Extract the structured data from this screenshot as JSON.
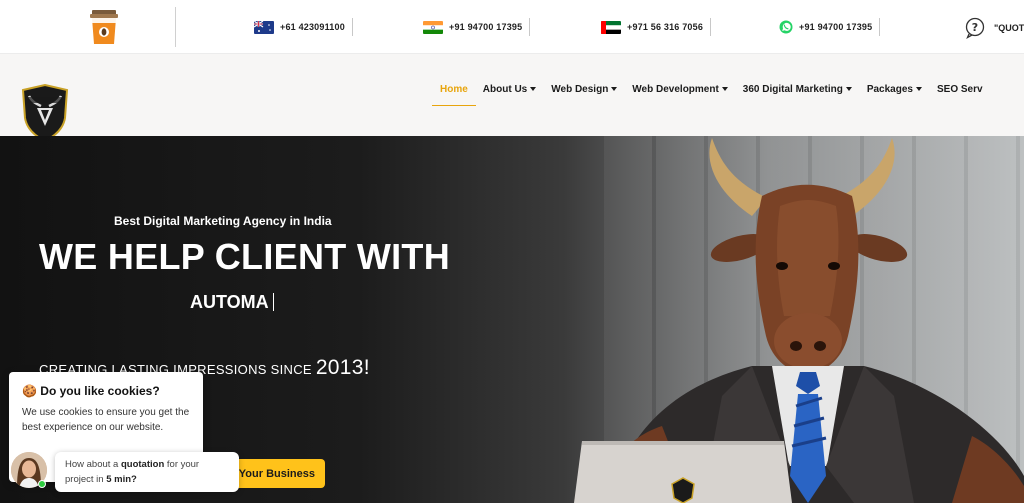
{
  "topbar": {
    "contacts": [
      {
        "flag": "australia-flag",
        "phone": "+61 423091100"
      },
      {
        "flag": "india-flag",
        "phone": "+91 94700 17395"
      },
      {
        "flag": "uae-flag",
        "phone": "+971 56 316 7056"
      },
      {
        "flag": "whatsapp-icon",
        "phone": "+91 94700 17395"
      }
    ],
    "quote_label": "\"QUOTE"
  },
  "nav": {
    "items": [
      {
        "label": "Home",
        "active": true,
        "dropdown": false
      },
      {
        "label": "About Us",
        "active": false,
        "dropdown": true
      },
      {
        "label": "Web Design",
        "active": false,
        "dropdown": true
      },
      {
        "label": "Web Development",
        "active": false,
        "dropdown": true
      },
      {
        "label": "360 Digital Marketing",
        "active": false,
        "dropdown": true
      },
      {
        "label": "Packages",
        "active": false,
        "dropdown": true
      },
      {
        "label": "SEO Serv",
        "active": false,
        "dropdown": false
      }
    ]
  },
  "hero": {
    "subtitle": "Best Digital Marketing Agency in India",
    "headline": "WE HELP CLIENT WITH",
    "typed_text": "AUTOMA",
    "since_text": "CREATING LASTING IMPRESSIONS SINCE",
    "since_year": "2013!",
    "cta_label": "Your Business"
  },
  "cookie": {
    "title": "Do you like cookies?",
    "body": "We use cookies to ensure you get the best experience on our website."
  },
  "chat": {
    "prefix": "How about a",
    "highlight1": "quotation",
    "middle": "for your project in",
    "highlight2": "5 min?"
  },
  "colors": {
    "accent": "#e8a50d",
    "cta": "#ffc21a",
    "hero_dark": "#121212"
  }
}
